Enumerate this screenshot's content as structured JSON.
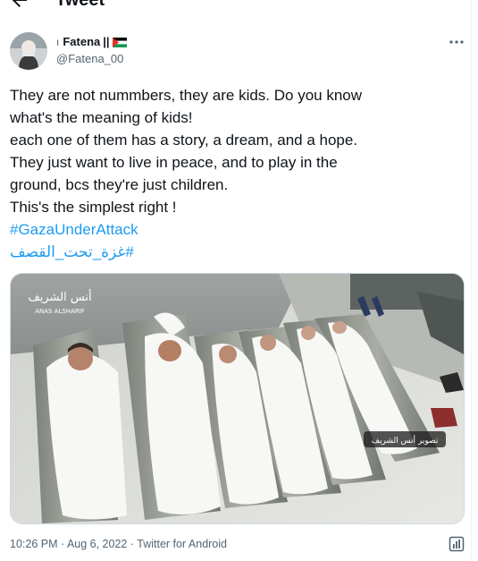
{
  "header": {
    "title": "Tweet",
    "back_icon": "arrow-left-icon"
  },
  "author": {
    "lead_mark": "ı",
    "name": "Fatena",
    "badge_text": "||",
    "flag_icon": "palestine-flag-icon",
    "handle": "@Fatena_00",
    "more_icon": "more-horizontal-icon"
  },
  "tweet": {
    "lines": [
      "They are not nummbers, they are kids. Do you know",
      "what's the meaning of kids!",
      "each one of them has a story, a dream, and a hope.",
      "They just want to live in peace, and to play in the",
      "ground, bcs they're just children.",
      "This's the simplest right !"
    ],
    "hashtag_1": "#GazaUnderAttack",
    "hashtag_2": "#غزة_تحت_القصف"
  },
  "media": {
    "logo_text": "أنس الشريف",
    "logo_subtext": "ANAS ALSHARIF",
    "caption_overlay": "تصوير أنس الشريف"
  },
  "meta": {
    "time": "10:26 PM",
    "separator_1": " · ",
    "date": "Aug 6, 2022",
    "separator_2": " · ",
    "source": "Twitter for Android",
    "analytics_icon": "analytics-icon"
  },
  "colors": {
    "accent": "#1d9bf0",
    "secondary_text": "#536471",
    "primary_text": "#0f1419"
  }
}
